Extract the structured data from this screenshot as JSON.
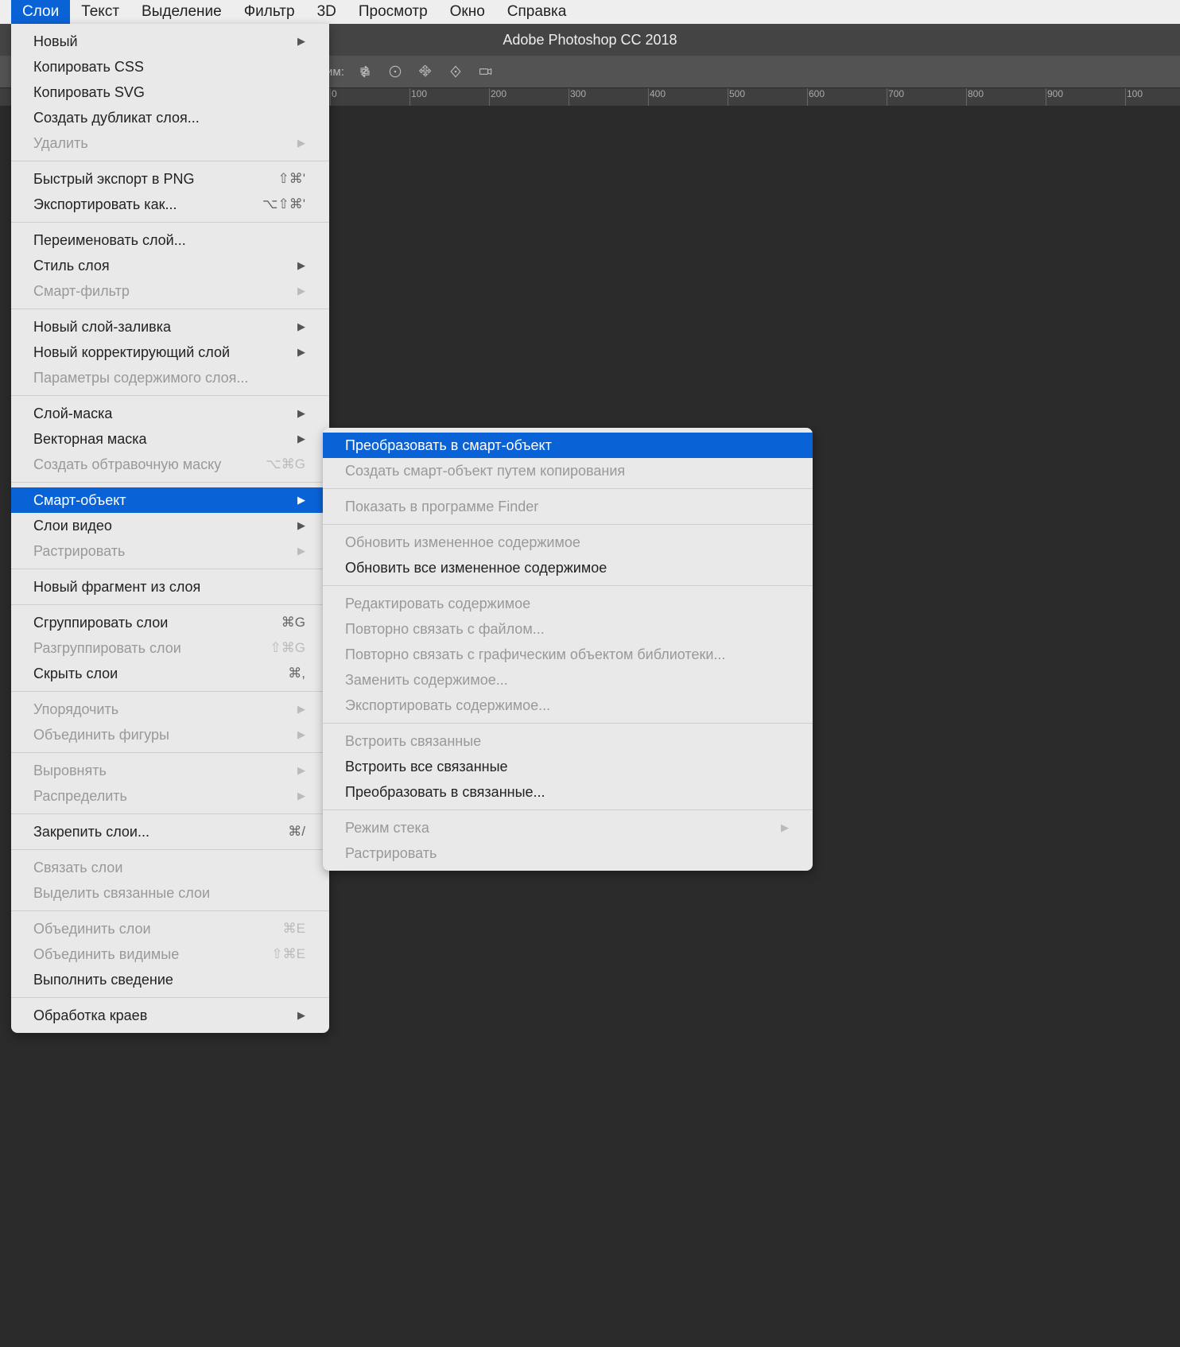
{
  "app_title": "Adobe Photoshop CC 2018",
  "menubar": {
    "items": [
      {
        "label": "Слои",
        "active": true
      },
      {
        "label": "Текст"
      },
      {
        "label": "Выделение"
      },
      {
        "label": "Фильтр"
      },
      {
        "label": "3D"
      },
      {
        "label": "Просмотр"
      },
      {
        "label": "Окно"
      },
      {
        "label": "Справка"
      }
    ]
  },
  "options_bar": {
    "label": "жим:"
  },
  "ruler": {
    "ticks": [
      "0",
      "100",
      "200",
      "300",
      "400",
      "500",
      "600",
      "700",
      "800",
      "900",
      "100"
    ]
  },
  "menu_main": [
    {
      "type": "item",
      "label": "Новый",
      "arrow": true
    },
    {
      "type": "item",
      "label": "Копировать CSS"
    },
    {
      "type": "item",
      "label": "Копировать SVG"
    },
    {
      "type": "item",
      "label": "Создать дубликат слоя..."
    },
    {
      "type": "item",
      "label": "Удалить",
      "arrow": true,
      "disabled": true
    },
    {
      "type": "sep"
    },
    {
      "type": "item",
      "label": "Быстрый экспорт в PNG",
      "shortcut": "⇧⌘'"
    },
    {
      "type": "item",
      "label": "Экспортировать как...",
      "shortcut": "⌥⇧⌘'"
    },
    {
      "type": "sep"
    },
    {
      "type": "item",
      "label": "Переименовать слой..."
    },
    {
      "type": "item",
      "label": "Стиль слоя",
      "arrow": true
    },
    {
      "type": "item",
      "label": "Смарт-фильтр",
      "arrow": true,
      "disabled": true
    },
    {
      "type": "sep"
    },
    {
      "type": "item",
      "label": "Новый слой-заливка",
      "arrow": true
    },
    {
      "type": "item",
      "label": "Новый корректирующий слой",
      "arrow": true
    },
    {
      "type": "item",
      "label": "Параметры содержимого слоя...",
      "disabled": true
    },
    {
      "type": "sep"
    },
    {
      "type": "item",
      "label": "Слой-маска",
      "arrow": true
    },
    {
      "type": "item",
      "label": "Векторная маска",
      "arrow": true
    },
    {
      "type": "item",
      "label": "Создать обтравочную маску",
      "shortcut": "⌥⌘G",
      "disabled": true
    },
    {
      "type": "sep"
    },
    {
      "type": "item",
      "label": "Смарт-объект",
      "arrow": true,
      "highlight": true
    },
    {
      "type": "item",
      "label": "Слои видео",
      "arrow": true
    },
    {
      "type": "item",
      "label": "Растрировать",
      "arrow": true,
      "disabled": true
    },
    {
      "type": "sep"
    },
    {
      "type": "item",
      "label": "Новый фрагмент из слоя"
    },
    {
      "type": "sep"
    },
    {
      "type": "item",
      "label": "Сгруппировать слои",
      "shortcut": "⌘G"
    },
    {
      "type": "item",
      "label": "Разгруппировать слои",
      "shortcut": "⇧⌘G",
      "disabled": true
    },
    {
      "type": "item",
      "label": "Скрыть слои",
      "shortcut": "⌘,"
    },
    {
      "type": "sep"
    },
    {
      "type": "item",
      "label": "Упорядочить",
      "arrow": true,
      "disabled": true
    },
    {
      "type": "item",
      "label": "Объединить фигуры",
      "arrow": true,
      "disabled": true
    },
    {
      "type": "sep"
    },
    {
      "type": "item",
      "label": "Выровнять",
      "arrow": true,
      "disabled": true
    },
    {
      "type": "item",
      "label": "Распределить",
      "arrow": true,
      "disabled": true
    },
    {
      "type": "sep"
    },
    {
      "type": "item",
      "label": "Закрепить слои...",
      "shortcut": "⌘/"
    },
    {
      "type": "sep"
    },
    {
      "type": "item",
      "label": "Связать слои",
      "disabled": true
    },
    {
      "type": "item",
      "label": "Выделить связанные слои",
      "disabled": true
    },
    {
      "type": "sep"
    },
    {
      "type": "item",
      "label": "Объединить слои",
      "shortcut": "⌘E",
      "disabled": true
    },
    {
      "type": "item",
      "label": "Объединить видимые",
      "shortcut": "⇧⌘E",
      "disabled": true
    },
    {
      "type": "item",
      "label": "Выполнить сведение"
    },
    {
      "type": "sep"
    },
    {
      "type": "item",
      "label": "Обработка краев",
      "arrow": true
    }
  ],
  "menu_sub": [
    {
      "type": "item",
      "label": "Преобразовать в смарт-объект",
      "highlight": true
    },
    {
      "type": "item",
      "label": "Создать смарт-объект путем копирования",
      "disabled": true
    },
    {
      "type": "sep"
    },
    {
      "type": "item",
      "label": "Показать в программе Finder",
      "disabled": true
    },
    {
      "type": "sep"
    },
    {
      "type": "item",
      "label": "Обновить измененное содержимое",
      "disabled": true
    },
    {
      "type": "item",
      "label": "Обновить все измененное содержимое"
    },
    {
      "type": "sep"
    },
    {
      "type": "item",
      "label": "Редактировать содержимое",
      "disabled": true
    },
    {
      "type": "item",
      "label": "Повторно связать с файлом...",
      "disabled": true
    },
    {
      "type": "item",
      "label": "Повторно связать с графическим объектом библиотеки...",
      "disabled": true
    },
    {
      "type": "item",
      "label": "Заменить содержимое...",
      "disabled": true
    },
    {
      "type": "item",
      "label": "Экспортировать содержимое...",
      "disabled": true
    },
    {
      "type": "sep"
    },
    {
      "type": "item",
      "label": "Встроить связанные",
      "disabled": true
    },
    {
      "type": "item",
      "label": "Встроить все связанные"
    },
    {
      "type": "item",
      "label": "Преобразовать в связанные..."
    },
    {
      "type": "sep"
    },
    {
      "type": "item",
      "label": "Режим стека",
      "arrow": true,
      "disabled": true
    },
    {
      "type": "item",
      "label": "Растрировать",
      "disabled": true
    }
  ]
}
